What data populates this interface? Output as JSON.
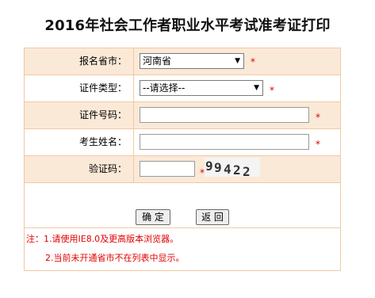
{
  "page_title": "2016年社会工作者职业水平考试准考证打印",
  "form": {
    "province": {
      "label": "报名省市：",
      "value": "河南省"
    },
    "id_type": {
      "label": "证件类型：",
      "value": "--请选择--"
    },
    "id_number": {
      "label": "证件号码：",
      "value": ""
    },
    "name": {
      "label": "考生姓名：",
      "value": ""
    },
    "captcha": {
      "label": "验证码：",
      "value": "",
      "image_text": "99422"
    },
    "required_mark": "*"
  },
  "buttons": {
    "confirm": "确 定",
    "back": "返 回"
  },
  "notes": {
    "line1": "注：1.请使用IE8.0及更高版本浏览器。",
    "line2": "2.当前未开通省市不在列表中显示。"
  },
  "colors": {
    "row_alt_bg": "#fbe9d7",
    "border": "#f0c9a4",
    "required": "#e00000"
  }
}
